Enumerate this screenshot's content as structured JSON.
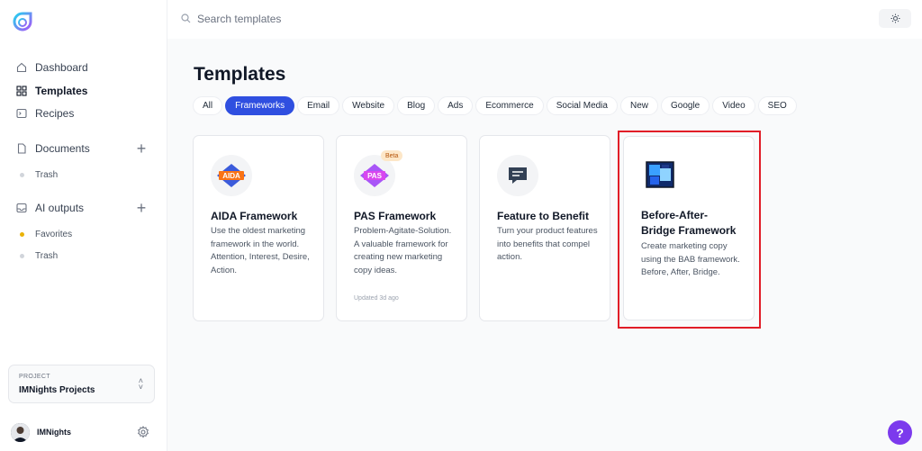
{
  "sidebar": {
    "nav": [
      {
        "label": "Dashboard",
        "icon": "home-icon"
      },
      {
        "label": "Templates",
        "icon": "grid-icon",
        "active": true
      },
      {
        "label": "Recipes",
        "icon": "terminal-icon"
      }
    ],
    "documents": {
      "label": "Documents",
      "trash": "Trash"
    },
    "ai_outputs": {
      "label": "AI outputs",
      "favorites": "Favorites",
      "trash": "Trash"
    },
    "project": {
      "label": "PROJECT",
      "value": "IMNights Projects"
    },
    "user": {
      "name": "IMNights"
    }
  },
  "topbar": {
    "search_placeholder": "Search templates"
  },
  "page": {
    "title": "Templates"
  },
  "filters": [
    "All",
    "Frameworks",
    "Email",
    "Website",
    "Blog",
    "Ads",
    "Ecommerce",
    "Social Media",
    "New",
    "Google",
    "Video",
    "SEO"
  ],
  "active_filter": "Frameworks",
  "cards": [
    {
      "title": "AIDA Framework",
      "description": "Use the oldest marketing framework in the world. Attention, Interest, Desire, Action.",
      "icon_text": "AIDA"
    },
    {
      "title": "PAS Framework",
      "description": "Problem-Agitate-Solution. A valuable framework for creating new marketing copy ideas.",
      "icon_text": "PAS",
      "badge": "Beta",
      "updated": "Updated 3d ago"
    },
    {
      "title": "Feature to Benefit",
      "description": "Turn your product features into benefits that compel action."
    },
    {
      "title": "Before-After-Bridge Framework",
      "description": "Create marketing copy using the BAB framework. Before, After, Bridge."
    }
  ],
  "help": {
    "label": "?"
  },
  "colors": {
    "accent": "#2f4fe0",
    "highlight": "#e11d27",
    "help": "#7c3aed"
  }
}
